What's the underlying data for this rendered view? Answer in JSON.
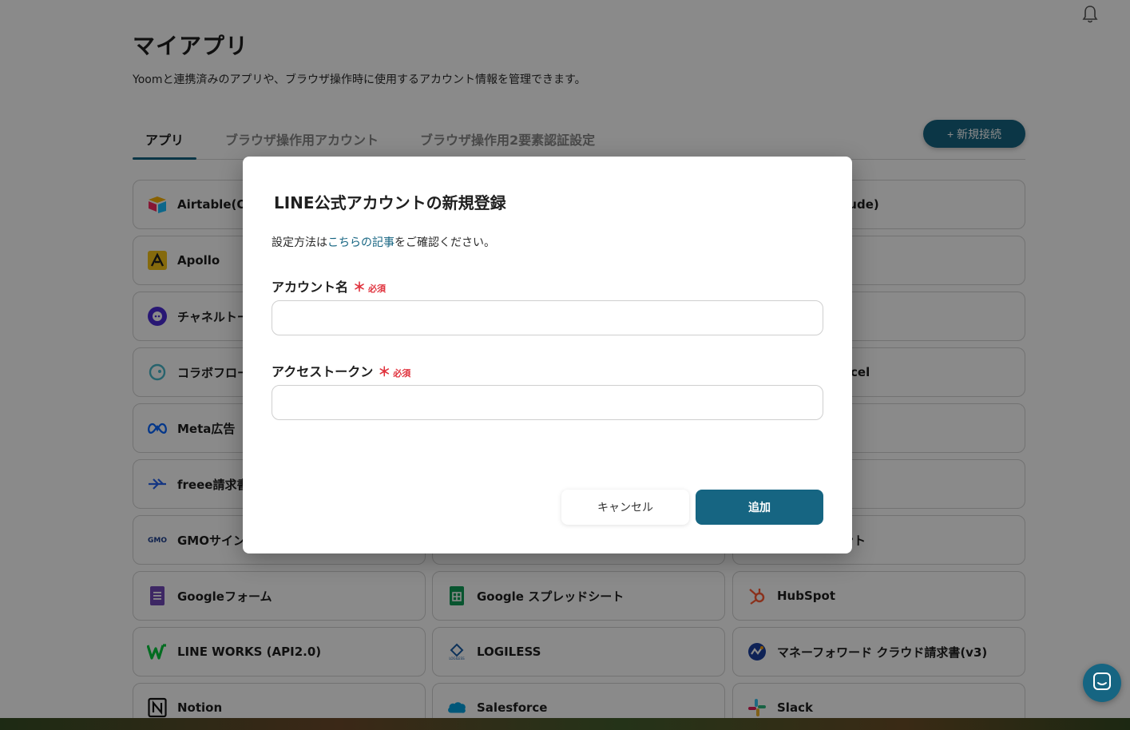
{
  "header": {
    "title": "マイアプリ",
    "description": "Yoomと連携済みのアプリや、ブラウザ操作時に使用するアカウント情報を管理できます。"
  },
  "tabs": [
    {
      "label": "アプリ",
      "active": true
    },
    {
      "label": "ブラウザ操作用アカウント",
      "active": false
    },
    {
      "label": "ブラウザ操作用2要素認証設定",
      "active": false
    }
  ],
  "new_button": {
    "label": "+ 新規接続"
  },
  "apps": [
    {
      "name": "Airtable(OA",
      "icon": "airtable-icon"
    },
    {
      "name": "Claude)",
      "icon": ""
    },
    {
      "name": "Apollo",
      "icon": "apollo-icon"
    },
    {
      "name": "チャネルトー",
      "icon": "channeltalk-icon"
    },
    {
      "name": "コラボフロー",
      "icon": "collaboflow-icon"
    },
    {
      "name": "cel",
      "icon": ""
    },
    {
      "name": "Meta広告（",
      "icon": "meta-icon"
    },
    {
      "name": "",
      "icon": ""
    },
    {
      "name": "freee請求書",
      "icon": "freee-icon"
    },
    {
      "name": "GMOサイン",
      "icon": "gmo-sign-icon"
    },
    {
      "name": "メント",
      "icon": ""
    },
    {
      "name": "Googleフォーム",
      "icon": "google-forms-icon"
    },
    {
      "name": "Google スプレッドシート",
      "icon": "google-sheets-icon"
    },
    {
      "name": "HubSpot",
      "icon": "hubspot-icon"
    },
    {
      "name": "LINE WORKS (API2.0)",
      "icon": "lineworks-icon"
    },
    {
      "name": "LOGILESS",
      "icon": "logiless-icon"
    },
    {
      "name": "マネーフォワード クラウド請求書(v3)",
      "icon": "moneyforward-icon"
    },
    {
      "name": "Notion",
      "icon": "notion-icon"
    },
    {
      "name": "Salesforce",
      "icon": "salesforce-icon"
    },
    {
      "name": "Slack",
      "icon": "slack-icon"
    }
  ],
  "modal": {
    "title": "LINE公式アカウントの新規登録",
    "info_prefix": "設定方法は",
    "info_link": "こちらの記事",
    "info_suffix": "をご確認ください。",
    "fields": [
      {
        "label": "アカウント名",
        "required_mark": "＊",
        "required_text": "必須",
        "value": ""
      },
      {
        "label": "アクセストークン",
        "required_mark": "＊",
        "required_text": "必須",
        "value": ""
      }
    ],
    "cancel_label": "キャンセル",
    "submit_label": "追加"
  },
  "colors": {
    "accent": "#166582",
    "required": "#e0323d"
  }
}
